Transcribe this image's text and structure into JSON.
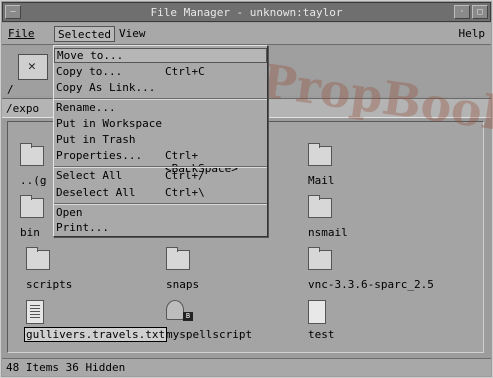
{
  "window": {
    "title": "File Manager - unknown:taylor",
    "minimize_glyph": "–",
    "right_btn1_glyph": "·",
    "right_btn2_glyph": "□"
  },
  "menubar": {
    "file": "File",
    "selected": "Selected",
    "view": "View",
    "help": "Help"
  },
  "toolbar": {
    "root_label": "/"
  },
  "pathbar": {
    "path": "/expo"
  },
  "dropdown": {
    "items": [
      {
        "label": "Move to...",
        "accel": ""
      },
      {
        "label": "Copy to...",
        "accel": "Ctrl+C"
      },
      {
        "label": "Copy As Link...",
        "accel": ""
      },
      {
        "label": "Rename...",
        "accel": ""
      },
      {
        "label": "Put in Workspace",
        "accel": ""
      },
      {
        "label": "Put in Trash",
        "accel": ""
      },
      {
        "label": "Properties...",
        "accel": "Ctrl+<BackSpace>"
      },
      {
        "label": "Select All",
        "accel": "Ctrl+/"
      },
      {
        "label": "Deselect All",
        "accel": "Ctrl+\\"
      },
      {
        "label": "Open",
        "accel": ""
      },
      {
        "label": "Print...",
        "accel": ""
      }
    ]
  },
  "files": [
    {
      "name": "..(g",
      "icon": "folder-icon"
    },
    {
      "name": "Mail",
      "icon": "folder-icon"
    },
    {
      "name": "bin",
      "icon": "folder-icon"
    },
    {
      "name": "nsmail",
      "icon": "folder-icon"
    },
    {
      "name": "scripts",
      "icon": "folder-icon"
    },
    {
      "name": "snaps",
      "icon": "folder-icon"
    },
    {
      "name": "vnc-3.3.6-sparc_2.5",
      "icon": "folder-icon"
    },
    {
      "name": "gullivers.travels.txt",
      "icon": "text-file-icon"
    },
    {
      "name": "myspellscript",
      "icon": "script-file-icon"
    },
    {
      "name": "test",
      "icon": "blank-file-icon"
    }
  ],
  "status": {
    "text": "48 Items 36 Hidden"
  },
  "watermark": {
    "text": "PropBook"
  }
}
